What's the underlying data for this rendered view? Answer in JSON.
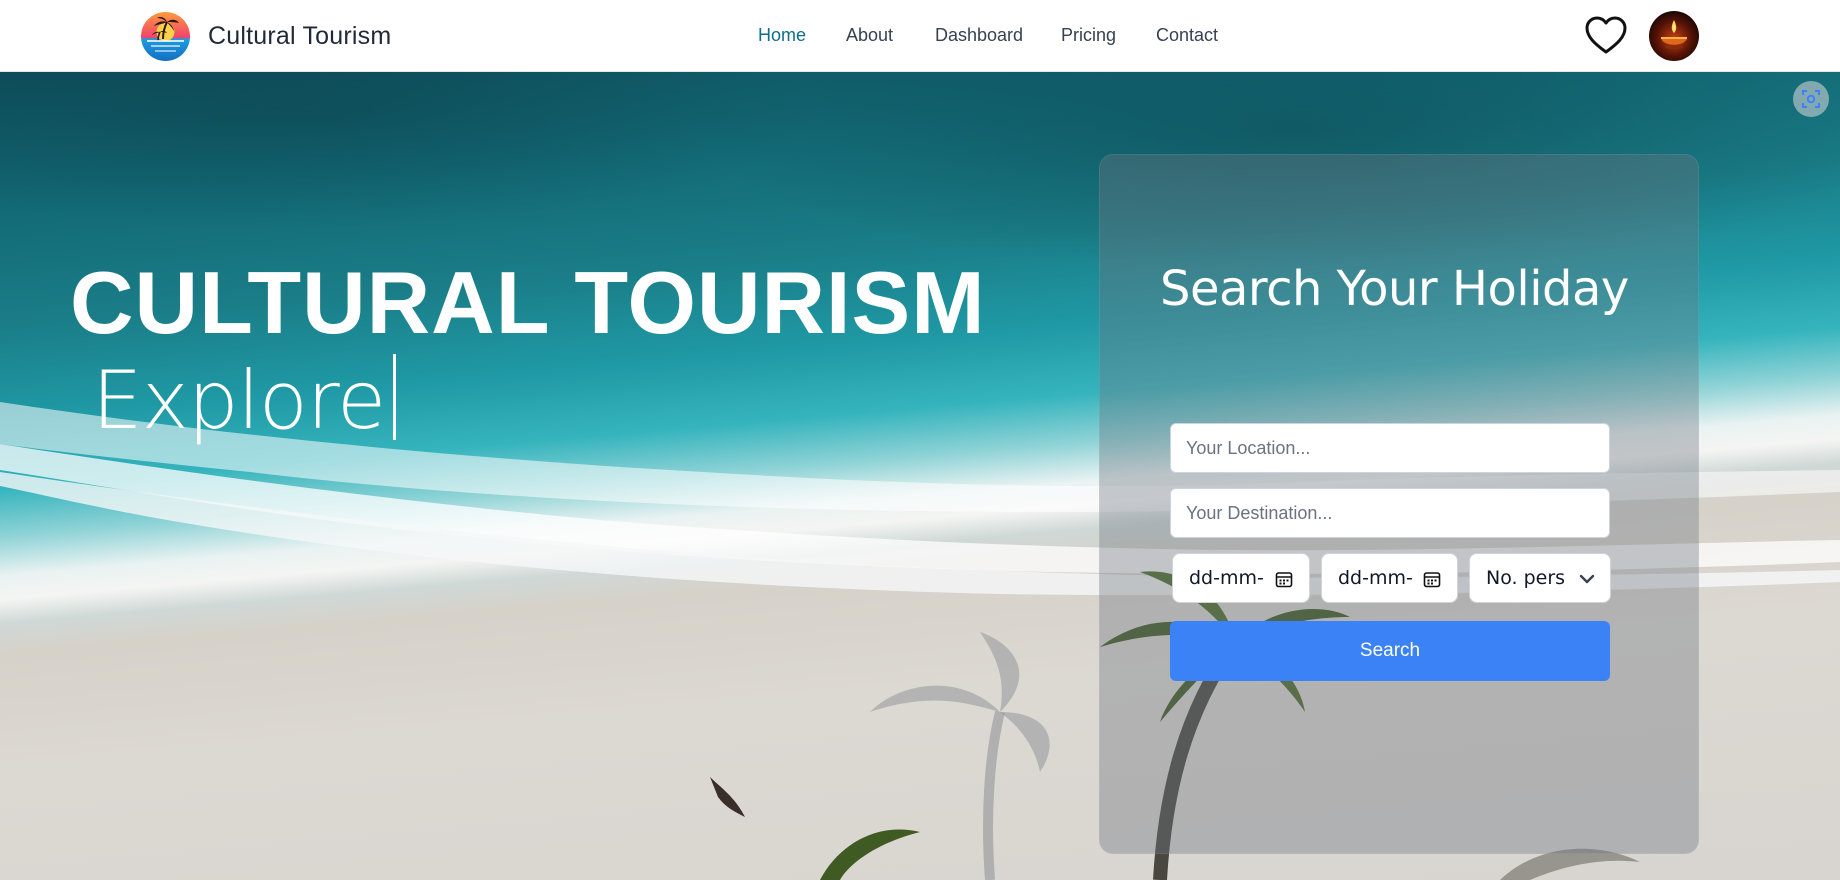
{
  "header": {
    "brand": "Cultural Tourism",
    "nav": [
      {
        "label": "Home",
        "active": true
      },
      {
        "label": "About",
        "active": false
      },
      {
        "label": "Dashboard",
        "active": false
      },
      {
        "label": "Pricing",
        "active": false
      },
      {
        "label": "Contact",
        "active": false
      }
    ],
    "favorites_icon": "heart-outline-icon",
    "avatar_icon": "diya-lamp-avatar"
  },
  "hero": {
    "title": "CULTURAL TOURISM",
    "typed_text": "Explore",
    "corner_icon": "screenshot-capture-icon"
  },
  "search": {
    "title": "Search Your Holiday",
    "location_placeholder": "Your Location...",
    "destination_placeholder": "Your Destination...",
    "checkin_value": "dd-mm-",
    "checkout_value": "dd-mm-",
    "persons_value": "No. pers",
    "button_label": "Search"
  },
  "colors": {
    "active_nav": "#0e6e8c",
    "search_button": "#3b82f6",
    "header_bg": "#ffffff"
  }
}
